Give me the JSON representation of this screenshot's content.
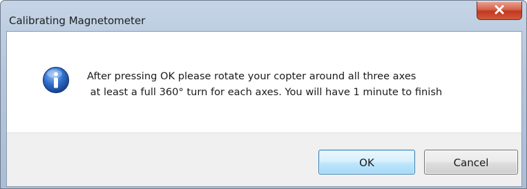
{
  "window": {
    "title": "Calibrating Magnetometer",
    "close_icon": "close-x-icon"
  },
  "message": {
    "icon": "info-icon",
    "line1": "After pressing OK please rotate your copter around all three axes",
    "line2": " at least a full 360° turn for each axes. You will have 1 minute to finish"
  },
  "buttons": {
    "ok_label": "OK",
    "cancel_label": "Cancel"
  },
  "colors": {
    "title_bar": "#b5c6dc",
    "close_button": "#c9442a",
    "info_icon": "#2a63b9",
    "ok_button_border": "#3c7fb1",
    "button_area": "#f0f0f0"
  }
}
